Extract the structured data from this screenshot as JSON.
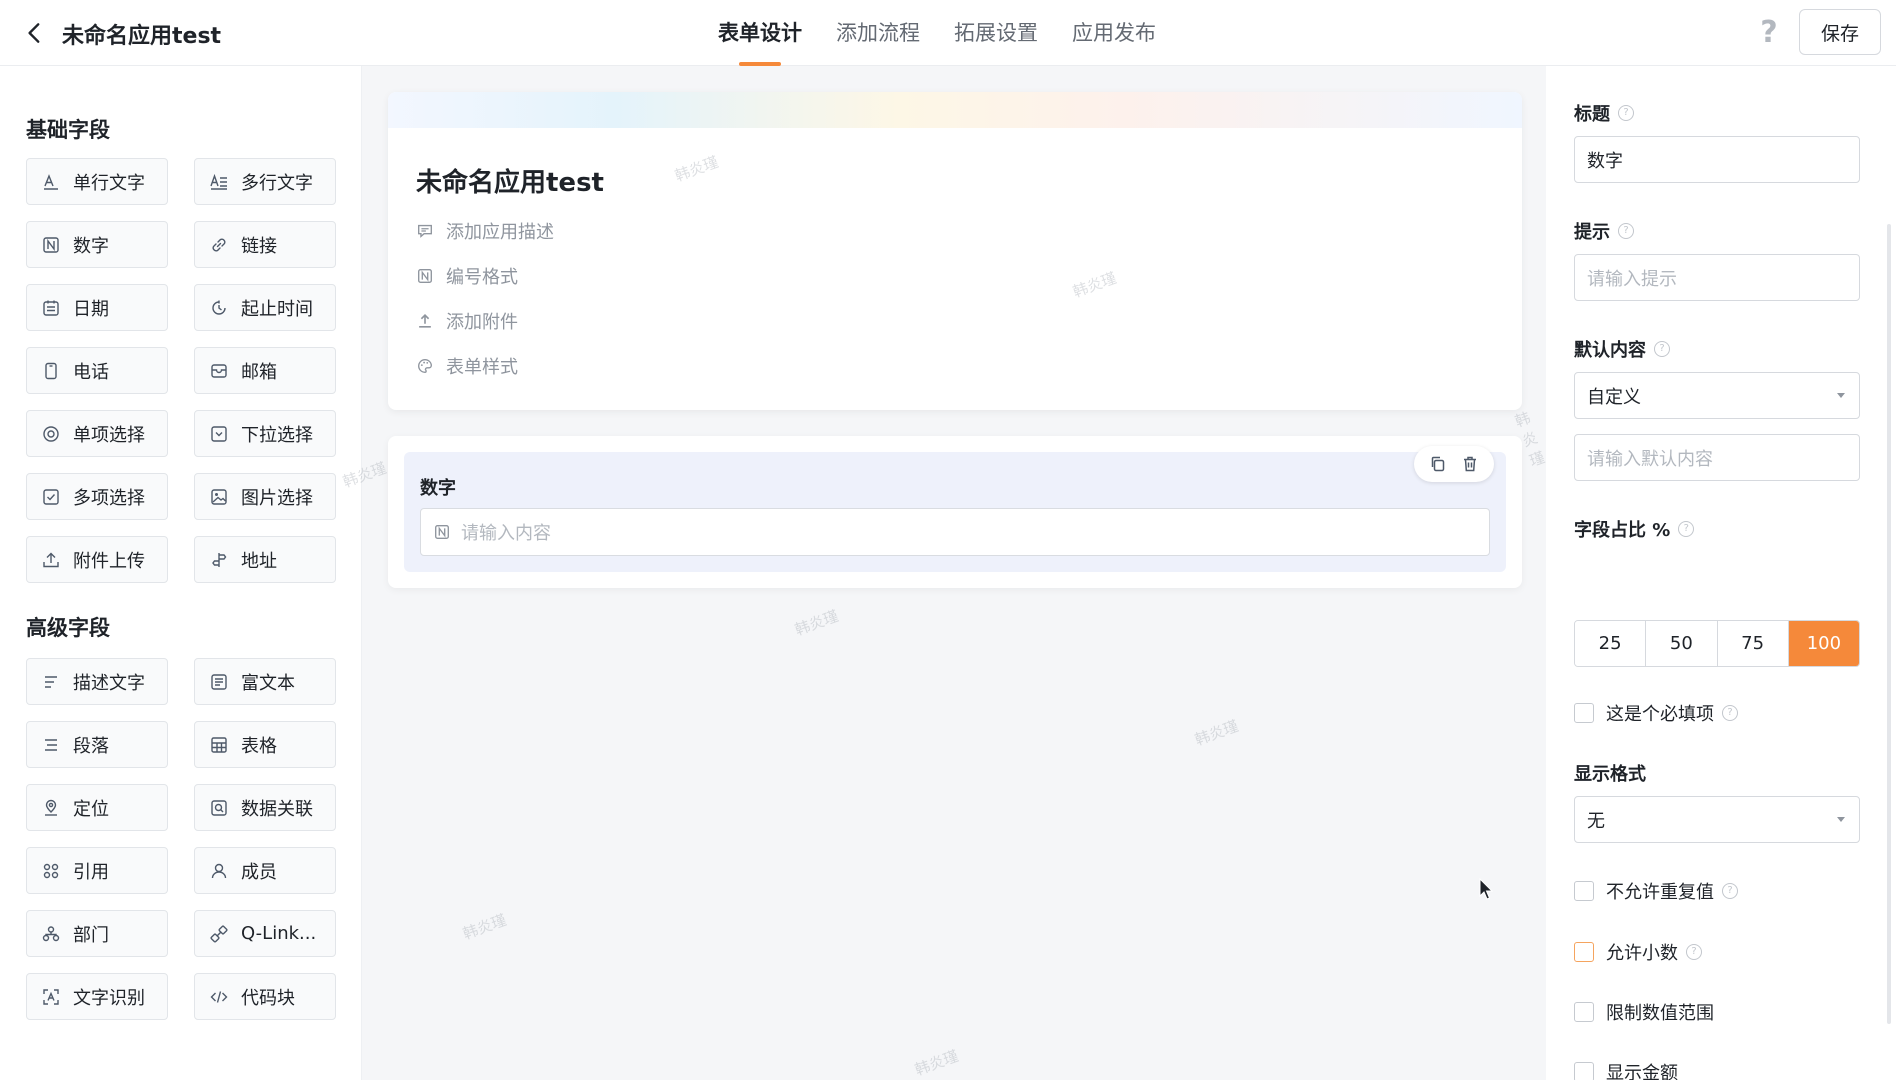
{
  "header": {
    "title": "未命名应用test",
    "tabs": [
      {
        "label": "表单设计",
        "active": true
      },
      {
        "label": "添加流程",
        "active": false
      },
      {
        "label": "拓展设置",
        "active": false
      },
      {
        "label": "应用发布",
        "active": false
      }
    ],
    "help_glyph": "?",
    "save_label": "保存",
    "accent_color": "#f5893a"
  },
  "sidebar": {
    "basic_title": "基础字段",
    "basic_fields": [
      {
        "label": "单行文字",
        "icon": "single-line-text-icon"
      },
      {
        "label": "多行文字",
        "icon": "multi-line-text-icon"
      },
      {
        "label": "数字",
        "icon": "number-icon"
      },
      {
        "label": "链接",
        "icon": "link-icon"
      },
      {
        "label": "日期",
        "icon": "calendar-icon"
      },
      {
        "label": "起止时间",
        "icon": "time-range-icon"
      },
      {
        "label": "电话",
        "icon": "phone-icon"
      },
      {
        "label": "邮箱",
        "icon": "mail-icon"
      },
      {
        "label": "单项选择",
        "icon": "radio-icon"
      },
      {
        "label": "下拉选择",
        "icon": "dropdown-icon"
      },
      {
        "label": "多项选择",
        "icon": "checkbox-icon"
      },
      {
        "label": "图片选择",
        "icon": "image-icon"
      },
      {
        "label": "附件上传",
        "icon": "upload-icon"
      },
      {
        "label": "地址",
        "icon": "address-icon"
      }
    ],
    "advanced_title": "高级字段",
    "advanced_fields": [
      {
        "label": "描述文字",
        "icon": "description-icon"
      },
      {
        "label": "富文本",
        "icon": "rich-text-icon"
      },
      {
        "label": "段落",
        "icon": "paragraph-icon"
      },
      {
        "label": "表格",
        "icon": "table-icon"
      },
      {
        "label": "定位",
        "icon": "location-icon"
      },
      {
        "label": "数据关联",
        "icon": "data-link-icon"
      },
      {
        "label": "引用",
        "icon": "reference-icon"
      },
      {
        "label": "成员",
        "icon": "member-icon"
      },
      {
        "label": "部门",
        "icon": "department-icon"
      },
      {
        "label": "Q-Link...",
        "icon": "q-link-icon"
      },
      {
        "label": "文字识别",
        "icon": "ocr-icon"
      },
      {
        "label": "代码块",
        "icon": "code-icon"
      }
    ]
  },
  "canvas": {
    "form_title": "未命名应用test",
    "meta": [
      {
        "label": "添加应用描述",
        "icon": "comment-icon"
      },
      {
        "label": "编号格式",
        "icon": "number-format-icon"
      },
      {
        "label": "添加附件",
        "icon": "upload-icon"
      },
      {
        "label": "表单样式",
        "icon": "palette-icon"
      }
    ],
    "field": {
      "label": "数字",
      "placeholder": "请输入内容"
    },
    "watermark": "韩炎瑾"
  },
  "properties": {
    "title_label": "标题",
    "title_value": "数字",
    "hint_label": "提示",
    "hint_placeholder": "请输入提示",
    "default_label": "默认内容",
    "default_select": "自定义",
    "default_placeholder": "请输入默认内容",
    "ratio_label": "字段占比 %",
    "ratio_options": [
      "25",
      "50",
      "75",
      "100"
    ],
    "ratio_selected": "100",
    "required_label": "这是个必填项",
    "display_format_label": "显示格式",
    "display_format_value": "无",
    "no_duplicate_label": "不允许重复值",
    "allow_decimal_label": "允许小数",
    "limit_range_label": "限制数值范围",
    "show_amount_label": "显示金额"
  }
}
